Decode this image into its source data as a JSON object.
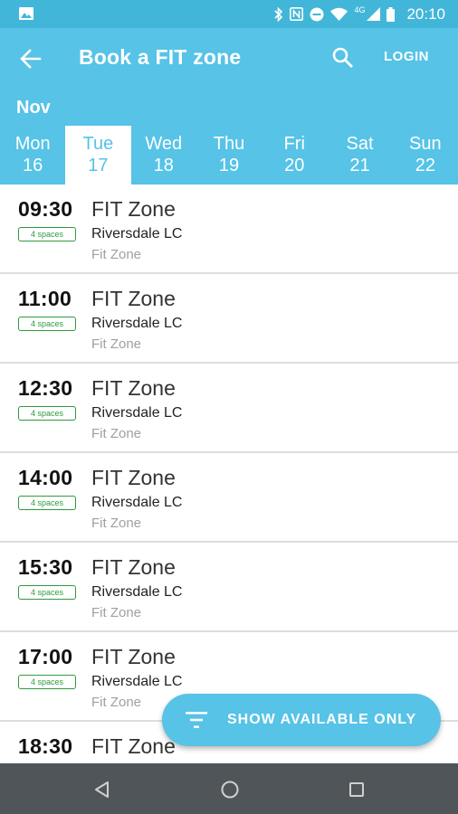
{
  "status_bar": {
    "network_label": "4G",
    "time": "20:10",
    "icons": [
      "gallery-icon",
      "bluetooth-icon",
      "nfc-icon",
      "dnd-icon",
      "wifi-icon",
      "signal-icon",
      "battery-icon"
    ]
  },
  "app_bar": {
    "title": "Book a FIT zone",
    "login_label": "LOGIN",
    "icons": [
      "back-arrow-icon",
      "search-icon"
    ]
  },
  "date_strip": {
    "month": "Nov",
    "selected_index": 1,
    "days": [
      {
        "name": "Mon",
        "num": "16"
      },
      {
        "name": "Tue",
        "num": "17"
      },
      {
        "name": "Wed",
        "num": "18"
      },
      {
        "name": "Thu",
        "num": "19"
      },
      {
        "name": "Fri",
        "num": "20"
      },
      {
        "name": "Sat",
        "num": "21"
      },
      {
        "name": "Sun",
        "num": "22"
      }
    ]
  },
  "sessions": [
    {
      "time": "09:30",
      "spaces": "4 spaces",
      "name": "FIT Zone",
      "venue": "Riversdale LC",
      "sub": "Fit Zone"
    },
    {
      "time": "11:00",
      "spaces": "4 spaces",
      "name": "FIT Zone",
      "venue": "Riversdale LC",
      "sub": "Fit Zone"
    },
    {
      "time": "12:30",
      "spaces": "4 spaces",
      "name": "FIT Zone",
      "venue": "Riversdale LC",
      "sub": "Fit Zone"
    },
    {
      "time": "14:00",
      "spaces": "4 spaces",
      "name": "FIT Zone",
      "venue": "Riversdale LC",
      "sub": "Fit Zone"
    },
    {
      "time": "15:30",
      "spaces": "4 spaces",
      "name": "FIT Zone",
      "venue": "Riversdale LC",
      "sub": "Fit Zone"
    },
    {
      "time": "17:00",
      "spaces": "4 spaces",
      "name": "FIT Zone",
      "venue": "Riversdale LC",
      "sub": "Fit Zone"
    },
    {
      "time": "18:30",
      "spaces": "",
      "name": "FIT Zone",
      "venue": "",
      "sub": ""
    }
  ],
  "fab": {
    "label": "SHOW AVAILABLE ONLY",
    "icon": "filter-icon"
  },
  "nav_bar": {
    "icons": [
      "nav-back-icon",
      "nav-home-icon",
      "nav-recents-icon"
    ]
  },
  "colors": {
    "primary": "#56c3e7",
    "status_bar": "#42b6d9",
    "available_badge": "#2e9a3c",
    "nav_bar": "#4f5558"
  }
}
